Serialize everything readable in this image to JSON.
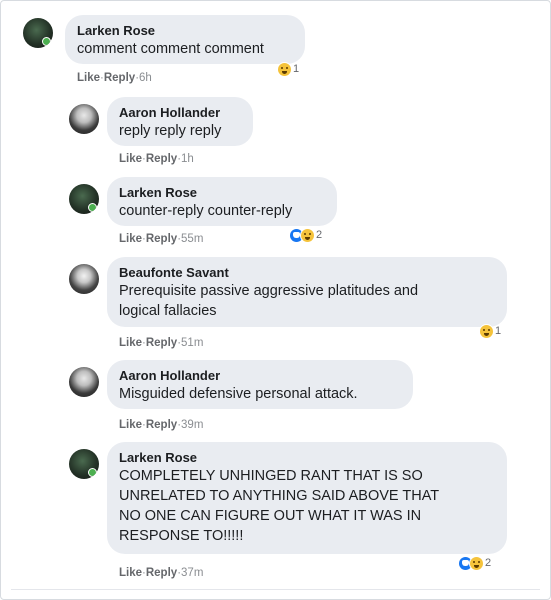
{
  "comments": [
    {
      "name": "Larken Rose",
      "text": "comment comment comment",
      "like": "Like",
      "reply": "Reply",
      "time": "6h",
      "reactions": "1"
    },
    {
      "name": "Aaron Hollander",
      "text": "reply reply reply",
      "like": "Like",
      "reply": "Reply",
      "time": "1h",
      "reactions": ""
    },
    {
      "name": "Larken Rose",
      "text": "counter-reply counter-reply",
      "like": "Like",
      "reply": "Reply",
      "time": "55m",
      "reactions": "2"
    },
    {
      "name": "Beaufonte Savant",
      "text_lines": [
        "Prerequisite passive aggressive platitudes and",
        "logical fallacies"
      ],
      "like": "Like",
      "reply": "Reply",
      "time": "51m",
      "reactions": "1"
    },
    {
      "name": "Aaron Hollander",
      "text": "Misguided defensive personal attack.",
      "like": "Like",
      "reply": "Reply",
      "time": "39m",
      "reactions": ""
    },
    {
      "name": "Larken Rose",
      "text_lines": [
        "COMPLETELY UNHINGED RANT THAT IS SO",
        "UNRELATED TO ANYTHING SAID ABOVE THAT",
        "NO ONE CAN FIGURE OUT WHAT IT WAS IN",
        "RESPONSE TO!!!!!"
      ],
      "like": "Like",
      "reply": "Reply",
      "time": "37m",
      "reactions": "2"
    }
  ],
  "separator": "·",
  "icons": {
    "haha": "haha-emoji-icon",
    "care": "care-emoji-icon"
  }
}
